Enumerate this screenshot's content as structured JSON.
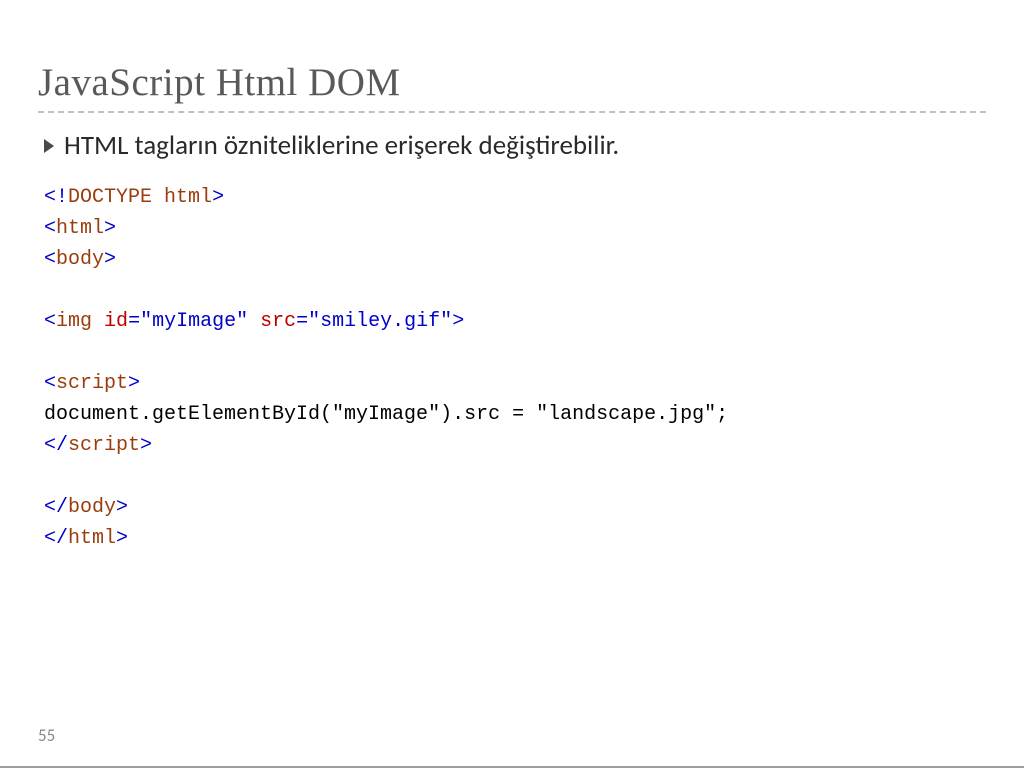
{
  "slide": {
    "title": "JavaScript Html DOM",
    "bullet_text": "HTML tagların özniteliklerine erişerek değiştirebilir.",
    "page_number": "55"
  },
  "code": {
    "lines": [
      {
        "segments": [
          {
            "t": "<!",
            "c": "bracket"
          },
          {
            "t": "DOCTYPE",
            "c": "doctype"
          },
          {
            "t": " ",
            "c": "plain"
          },
          {
            "t": "html",
            "c": "tagname"
          },
          {
            "t": ">",
            "c": "bracket"
          }
        ]
      },
      {
        "segments": [
          {
            "t": "<",
            "c": "bracket"
          },
          {
            "t": "html",
            "c": "tagname"
          },
          {
            "t": ">",
            "c": "bracket"
          }
        ]
      },
      {
        "segments": [
          {
            "t": "<",
            "c": "bracket"
          },
          {
            "t": "body",
            "c": "tagname"
          },
          {
            "t": ">",
            "c": "bracket"
          }
        ]
      },
      {
        "segments": []
      },
      {
        "segments": [
          {
            "t": "<",
            "c": "bracket"
          },
          {
            "t": "img",
            "c": "tagname"
          },
          {
            "t": " ",
            "c": "plain"
          },
          {
            "t": "id",
            "c": "attr"
          },
          {
            "t": "=",
            "c": "eq"
          },
          {
            "t": "\"myImage\"",
            "c": "val"
          },
          {
            "t": " ",
            "c": "plain"
          },
          {
            "t": "src",
            "c": "attr"
          },
          {
            "t": "=",
            "c": "eq"
          },
          {
            "t": "\"smiley.gif\"",
            "c": "val"
          },
          {
            "t": ">",
            "c": "bracket"
          }
        ]
      },
      {
        "segments": []
      },
      {
        "segments": [
          {
            "t": "<",
            "c": "bracket"
          },
          {
            "t": "script",
            "c": "tagname"
          },
          {
            "t": ">",
            "c": "bracket"
          }
        ]
      },
      {
        "segments": [
          {
            "t": "document.getElementById(\"myImage\").src = \"landscape.jpg\";",
            "c": "plain"
          }
        ]
      },
      {
        "segments": [
          {
            "t": "</",
            "c": "bracket"
          },
          {
            "t": "script",
            "c": "tagname"
          },
          {
            "t": ">",
            "c": "bracket"
          }
        ]
      },
      {
        "segments": []
      },
      {
        "segments": [
          {
            "t": "</",
            "c": "bracket"
          },
          {
            "t": "body",
            "c": "tagname"
          },
          {
            "t": ">",
            "c": "bracket"
          }
        ]
      },
      {
        "segments": [
          {
            "t": "</",
            "c": "bracket"
          },
          {
            "t": "html",
            "c": "tagname"
          },
          {
            "t": ">",
            "c": "bracket"
          }
        ]
      }
    ]
  }
}
